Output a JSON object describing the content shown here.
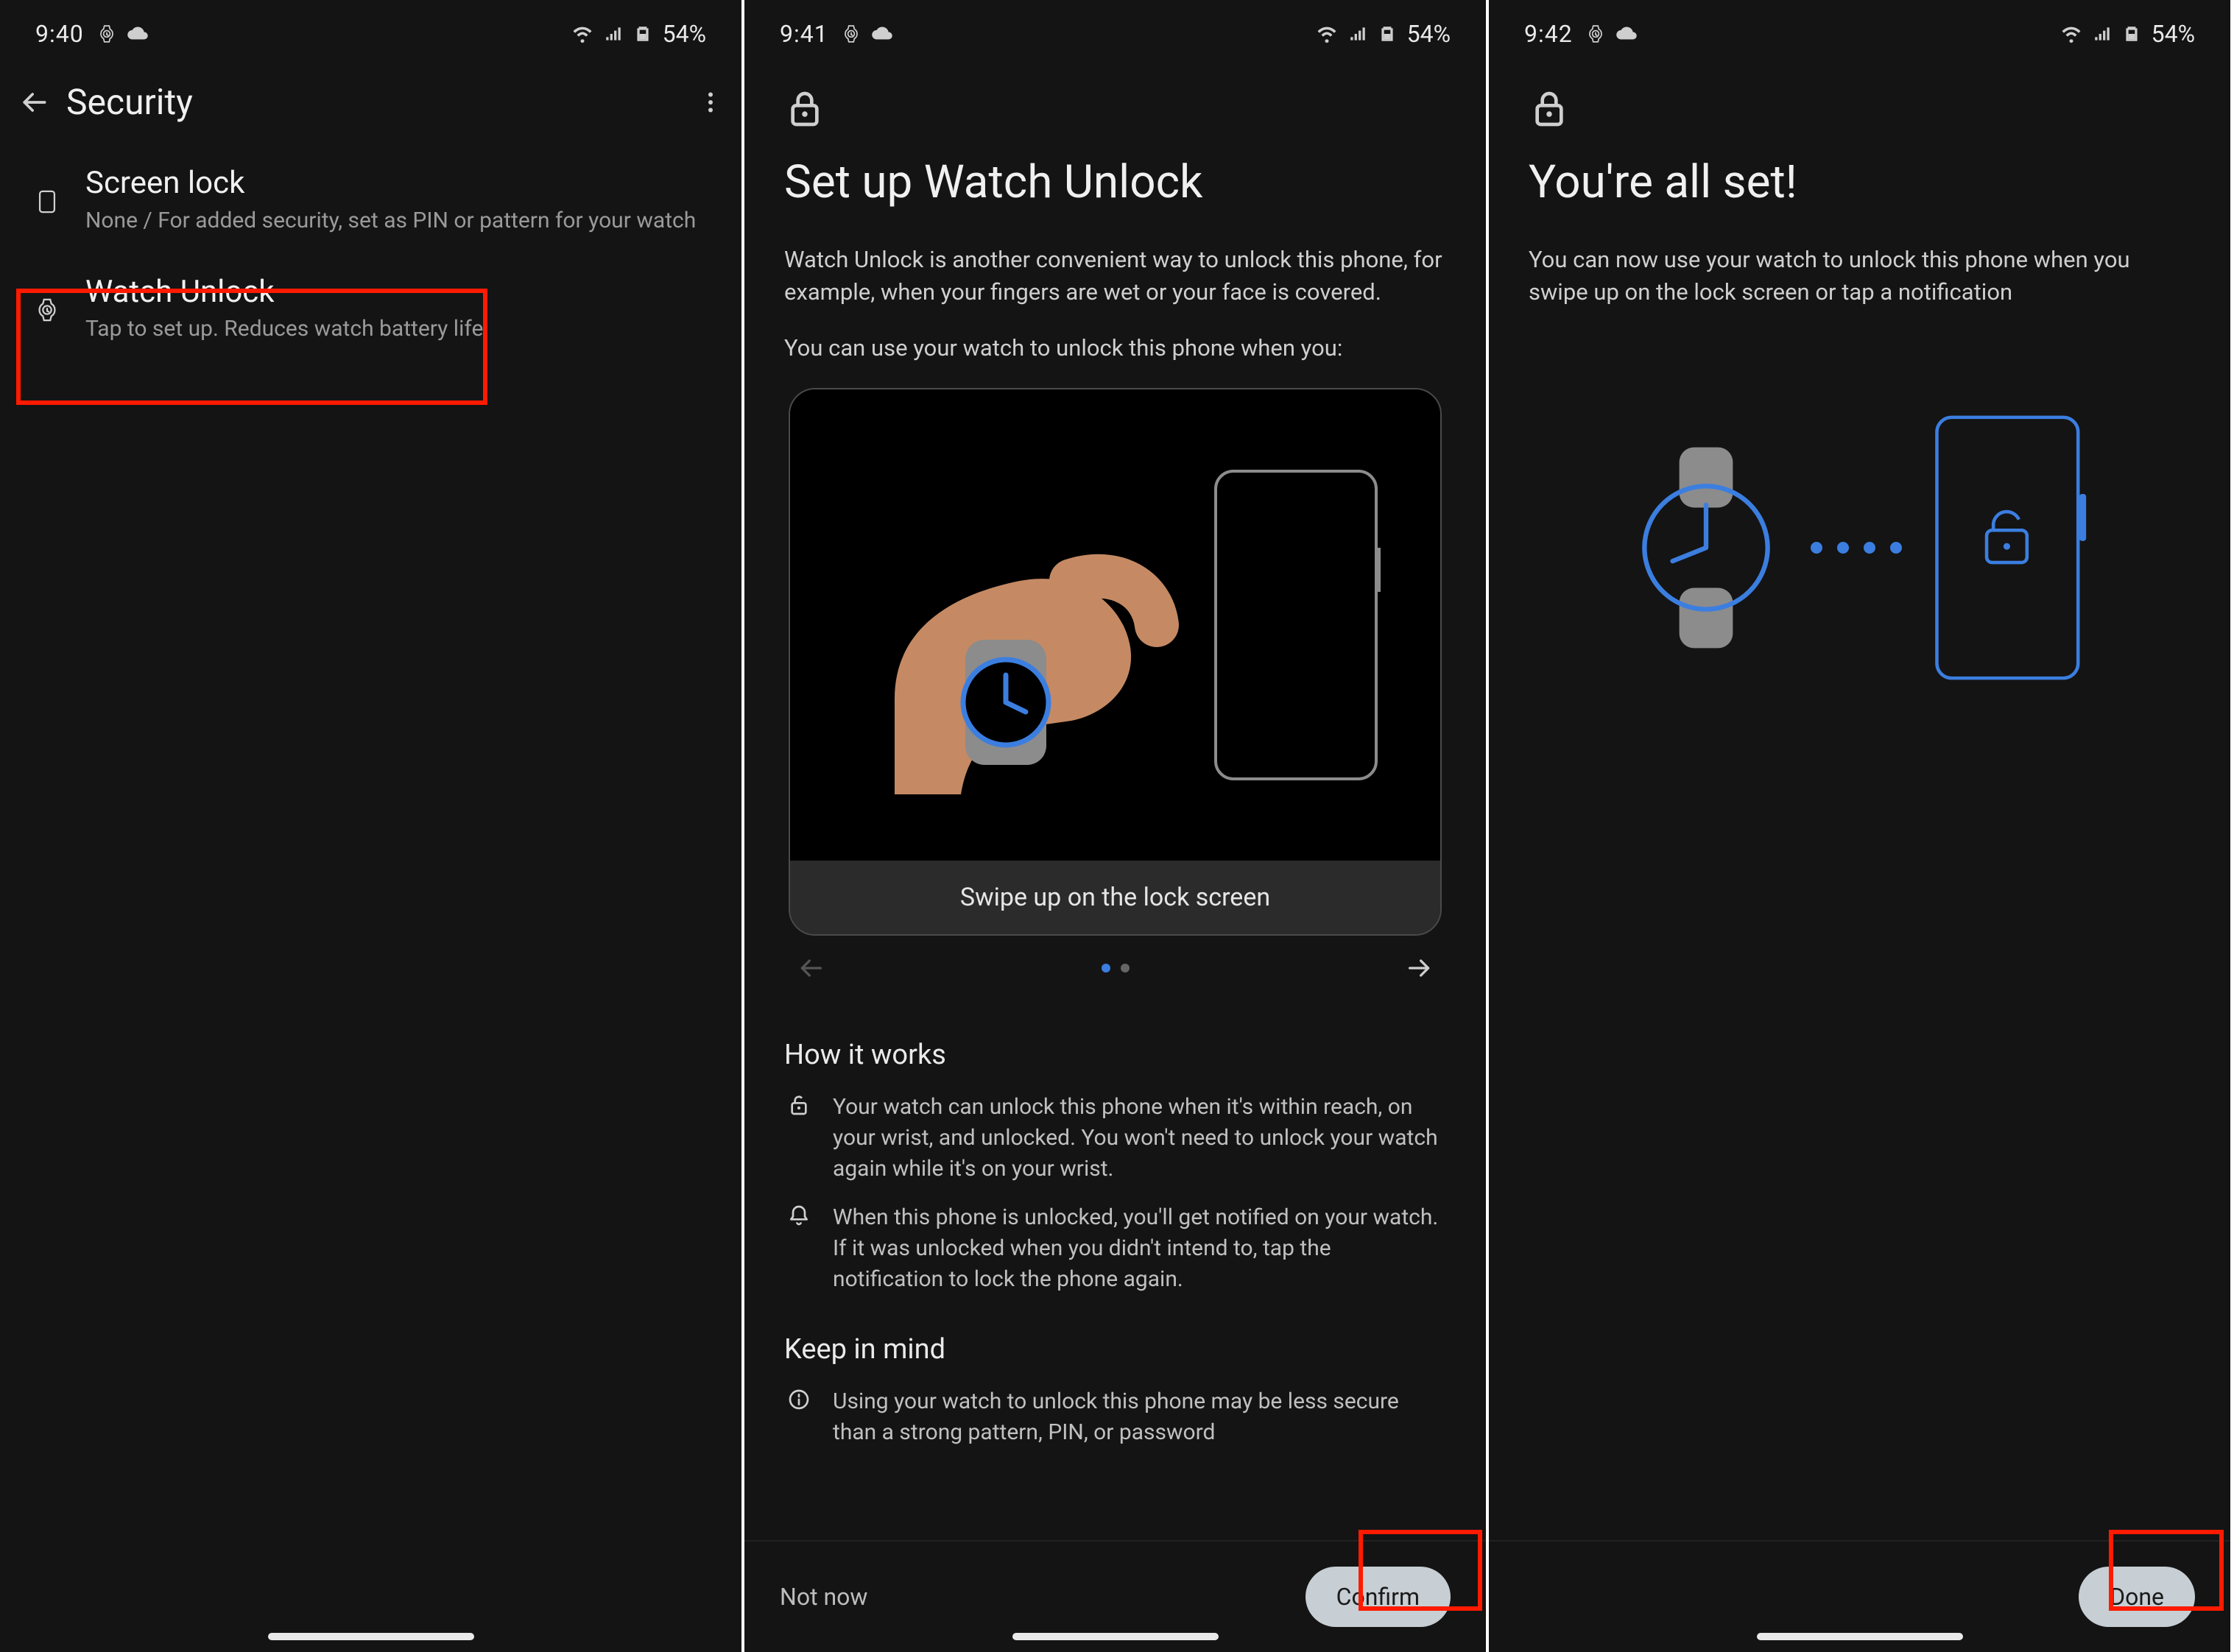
{
  "screens": [
    {
      "status": {
        "time": "9:40",
        "battery": "54%"
      },
      "header": {
        "title": "Security"
      },
      "rows": [
        {
          "title": "Screen lock",
          "sub": "None / For added security, set as PIN or pattern for your watch"
        },
        {
          "title": "Watch Unlock",
          "sub": "Tap to set up. Reduces watch battery life."
        }
      ]
    },
    {
      "status": {
        "time": "9:41",
        "battery": "54%"
      },
      "title": "Set up Watch Unlock",
      "intro1": "Watch Unlock is another convenient way to unlock this phone, for example, when your fingers are wet or your face is covered.",
      "intro2": "You can use your watch to unlock this phone when you:",
      "illus_caption": "Swipe up on the lock screen",
      "how": {
        "heading": "How it works",
        "items": [
          "Your watch can unlock this phone when it's within reach, on your wrist, and unlocked. You won't need to unlock your watch again while it's on your wrist.",
          "When this phone is unlocked, you'll get notified on your watch. If it was unlocked when you didn't intend to, tap the notification to lock the phone again."
        ]
      },
      "keep": {
        "heading": "Keep in mind",
        "items": [
          "Using your watch to unlock this phone may be less secure than a strong pattern, PIN, or password"
        ]
      },
      "bottom": {
        "link": "Not now",
        "primary": "Confirm"
      }
    },
    {
      "status": {
        "time": "9:42",
        "battery": "54%"
      },
      "title": "You're all set!",
      "body": "You can now use your watch to unlock this phone when you swipe up on the lock screen or tap a notification",
      "bottom": {
        "primary": "Done"
      }
    }
  ]
}
